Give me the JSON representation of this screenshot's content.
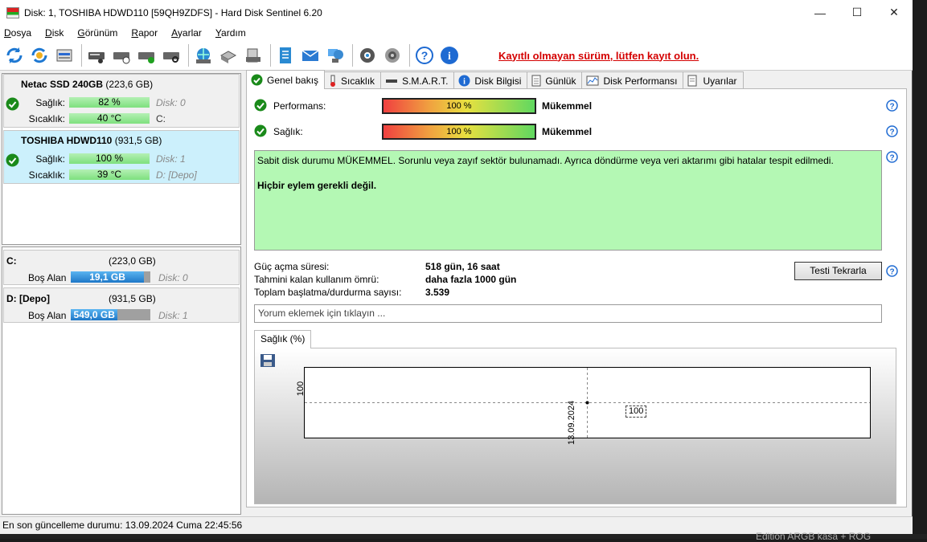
{
  "window": {
    "title": "Disk: 1, TOSHIBA HDWD110 [59QH9ZDFS]  -  Hard Disk Sentinel 6.20"
  },
  "menu": [
    "Dosya",
    "Disk",
    "Görünüm",
    "Rapor",
    "Ayarlar",
    "Yardım"
  ],
  "toolbar": {
    "register_warning": "Kayıtlı olmayan sürüm, lütfen kayıt olun."
  },
  "disks": [
    {
      "name": "Netac SSD 240GB",
      "size": "(223,6 GB)",
      "health_label": "Sağlık:",
      "health": "82 %",
      "health_side": "Disk: 0",
      "temp_label": "Sıcaklık:",
      "temp": "40 °C",
      "temp_side": "C:"
    },
    {
      "name": "TOSHIBA HDWD110",
      "size": "(931,5 GB)",
      "health_label": "Sağlık:",
      "health": "100 %",
      "health_side": "Disk: 1",
      "temp_label": "Sıcaklık:",
      "temp": "39 °C",
      "temp_side": "D: [Depo]"
    }
  ],
  "volumes": [
    {
      "name": "C:",
      "size": "(223,0 GB)",
      "free_label": "Boş Alan",
      "free": "19,1 GB",
      "free_fraction": 0.92,
      "side": "Disk: 0"
    },
    {
      "name": "D: [Depo]",
      "size": "(931,5 GB)",
      "free_label": "Boş Alan",
      "free": "549,0 GB",
      "free_fraction": 0.59,
      "side": "Disk: 1"
    }
  ],
  "tabs": [
    "Genel bakış",
    "Sıcaklık",
    "S.M.A.R.T.",
    "Disk Bilgisi",
    "Günlük",
    "Disk Performansı",
    "Uyarılar"
  ],
  "overview": {
    "performance_label": "Performans:",
    "performance_value": "100 %",
    "performance_text": "Mükemmel",
    "health_label": "Sağlık:",
    "health_value": "100 %",
    "health_text": "Mükemmel",
    "message": "Sabit disk durumu MÜKEMMEL. Sorunlu veya zayıf sektör bulunamadı. Ayrıca döndürme veya veri aktarımı gibi hatalar tespit edilmedi.",
    "action": "Hiçbir eylem gerekli değil.",
    "power_on_label": "Güç açma süresi:",
    "power_on": "518 gün, 16 saat",
    "lifetime_label": "Tahmini kalan kullanım ömrü:",
    "lifetime": "daha fazla 1000 gün",
    "startstop_label": "Toplam başlatma/durdurma sayısı:",
    "startstop": "3.539",
    "retest_button": "Testi Tekrarla",
    "comment_placeholder": "Yorum eklemek için tıklayın ..."
  },
  "health_chart_tab": "Sağlık (%)",
  "chart_data": {
    "type": "line",
    "x": [
      "13.09.2024"
    ],
    "values": [
      100
    ],
    "ytick": "100",
    "data_label": "100"
  },
  "status": "En son güncelleme durumu: 13.09.2024 Cuma 22:45:56",
  "background_text": "Edition ARGB kasa + ROG"
}
